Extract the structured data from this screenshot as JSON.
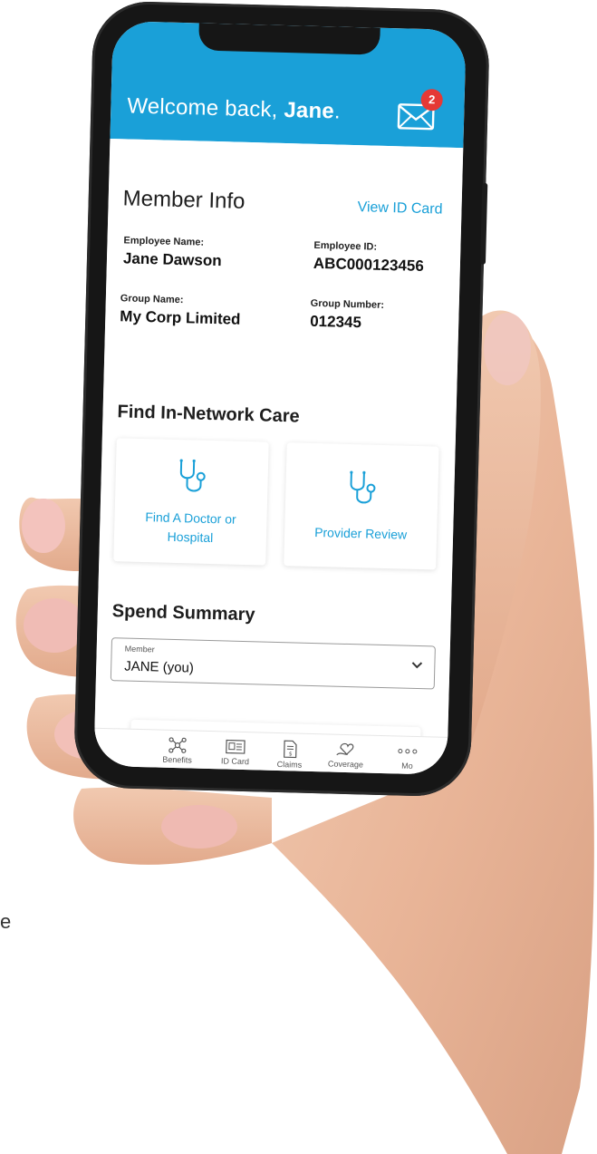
{
  "header": {
    "welcome_prefix": "Welcome back, ",
    "user_name": "Jane",
    "welcome_suffix": ".",
    "mail_badge_count": "2"
  },
  "member_info": {
    "title": "Member Info",
    "view_id_card": "View ID Card",
    "employee_name_label": "Employee Name:",
    "employee_name_value": "Jane Dawson",
    "employee_id_label": "Employee ID:",
    "employee_id_value": "ABC000123456",
    "group_name_label": "Group Name:",
    "group_name_value": "My Corp Limited",
    "group_number_label": "Group Number:",
    "group_number_value": "012345"
  },
  "care": {
    "title": "Find In-Network Care",
    "cards": [
      {
        "line1": "Find A Doctor or",
        "line2": "Hospital",
        "icon": "stethoscope-icon"
      },
      {
        "line1": "Provider Review",
        "icon": "stethoscope-icon"
      }
    ]
  },
  "spend": {
    "title": "Spend Summary",
    "member_caption": "Member",
    "member_selected": "JANE (you)"
  },
  "tabbar": {
    "tabs": [
      {
        "label": "Benefits",
        "icon": "benefits-icon"
      },
      {
        "label": "ID Card",
        "icon": "id-card-icon"
      },
      {
        "label": "Claims",
        "icon": "claims-icon"
      },
      {
        "label": "Coverage",
        "icon": "coverage-icon"
      },
      {
        "label": "Mo",
        "icon": "more-icon"
      }
    ]
  },
  "stray_text": "e",
  "colors": {
    "brand_blue": "#1aa0d8",
    "badge_red": "#e53935",
    "phone_body": "#161616"
  }
}
